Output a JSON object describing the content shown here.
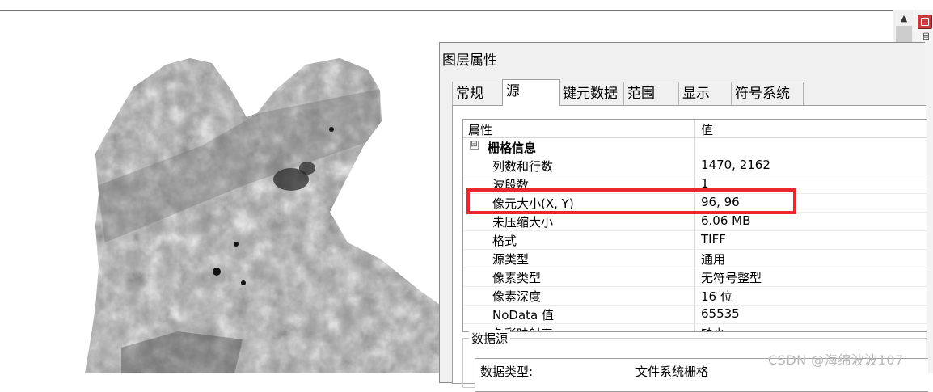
{
  "dialog": {
    "title": "图层属性",
    "tabs": [
      {
        "label": "常规"
      },
      {
        "label": "源"
      },
      {
        "label": "键元数据"
      },
      {
        "label": "范围"
      },
      {
        "label": "显示"
      },
      {
        "label": "符号系统"
      }
    ],
    "active_tab": "源"
  },
  "property_grid": {
    "header": {
      "property": "属性",
      "value": "值"
    },
    "group": {
      "toggle": "⊟",
      "name": "栅格信息"
    },
    "rows": [
      {
        "key": "列数和行数",
        "value": "1470, 2162"
      },
      {
        "key": "波段数",
        "value": "1"
      },
      {
        "key": "像元大小(X, Y)",
        "value": "96, 96"
      },
      {
        "key": "未压缩大小",
        "value": "6.06 MB"
      },
      {
        "key": "格式",
        "value": "TIFF"
      },
      {
        "key": "源类型",
        "value": "通用"
      },
      {
        "key": "像素类型",
        "value": "无符号整型"
      },
      {
        "key": "像素深度",
        "value": "16 位"
      },
      {
        "key": "NoData 值",
        "value": "65535"
      },
      {
        "key": "色彩映射表",
        "value": "缺少"
      }
    ]
  },
  "data_source": {
    "legend": "数据源",
    "row": {
      "key": "数据类型:",
      "value": "文件系统栅格"
    }
  },
  "watermark": "CSDN @海绵波波107",
  "scrollbar": {
    "up_arrow": "▲"
  },
  "side_panel": {
    "label": "目"
  },
  "colors": {
    "highlight": "#e8282e",
    "dialog_bg": "#f0f0f0",
    "panel_border": "#a0a0a0"
  }
}
